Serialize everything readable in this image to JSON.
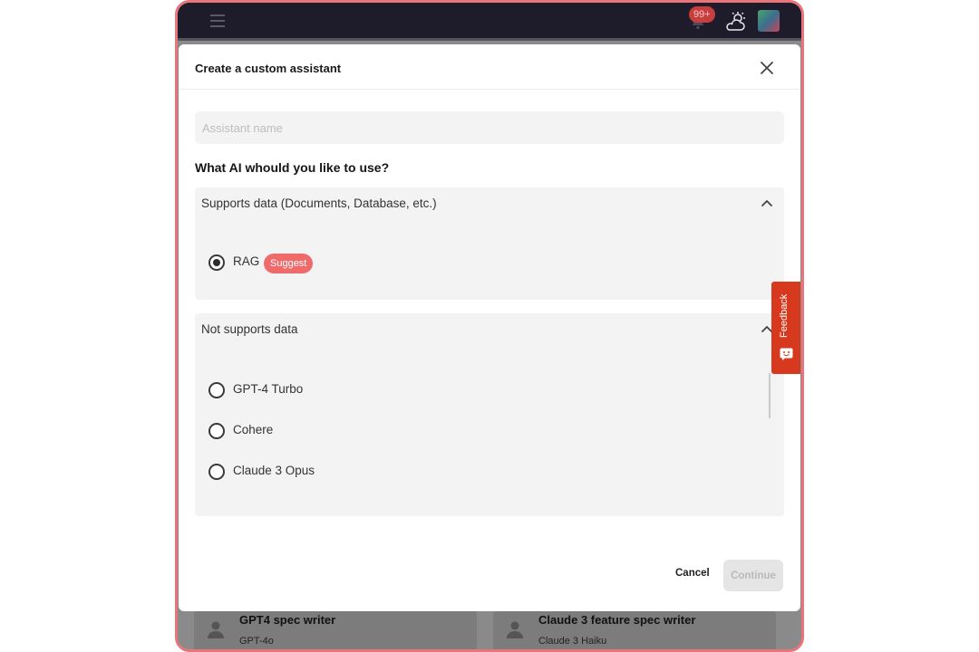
{
  "topbar": {
    "notifications_badge": "99+"
  },
  "background_cards": [
    {
      "title": "GPT4 spec writer",
      "model": "GPT-4o"
    },
    {
      "title": "Claude 3 feature spec writer",
      "model": "Claude 3 Haiku"
    }
  ],
  "modal": {
    "title": "Create a custom assistant",
    "name_input": {
      "value": "",
      "placeholder": "Assistant name"
    },
    "question": "What AI whould you like to use?",
    "sections": [
      {
        "header": "Supports data (Documents, Database, etc.)",
        "options": [
          {
            "label": "RAG",
            "selected": true,
            "badge": "Suggest"
          }
        ]
      },
      {
        "header": "Not supports data",
        "options": [
          {
            "label": "GPT-4 Turbo",
            "selected": false
          },
          {
            "label": "Cohere",
            "selected": false
          },
          {
            "label": "Claude 3 Opus",
            "selected": false
          }
        ]
      }
    ],
    "cancel_label": "Cancel",
    "continue_label": "Continue"
  },
  "feedback_label": "Feedback",
  "colors": {
    "accent_badge": "#ef6b6b",
    "feedback_tab": "#d6391d",
    "frame_border": "#e8757a"
  }
}
